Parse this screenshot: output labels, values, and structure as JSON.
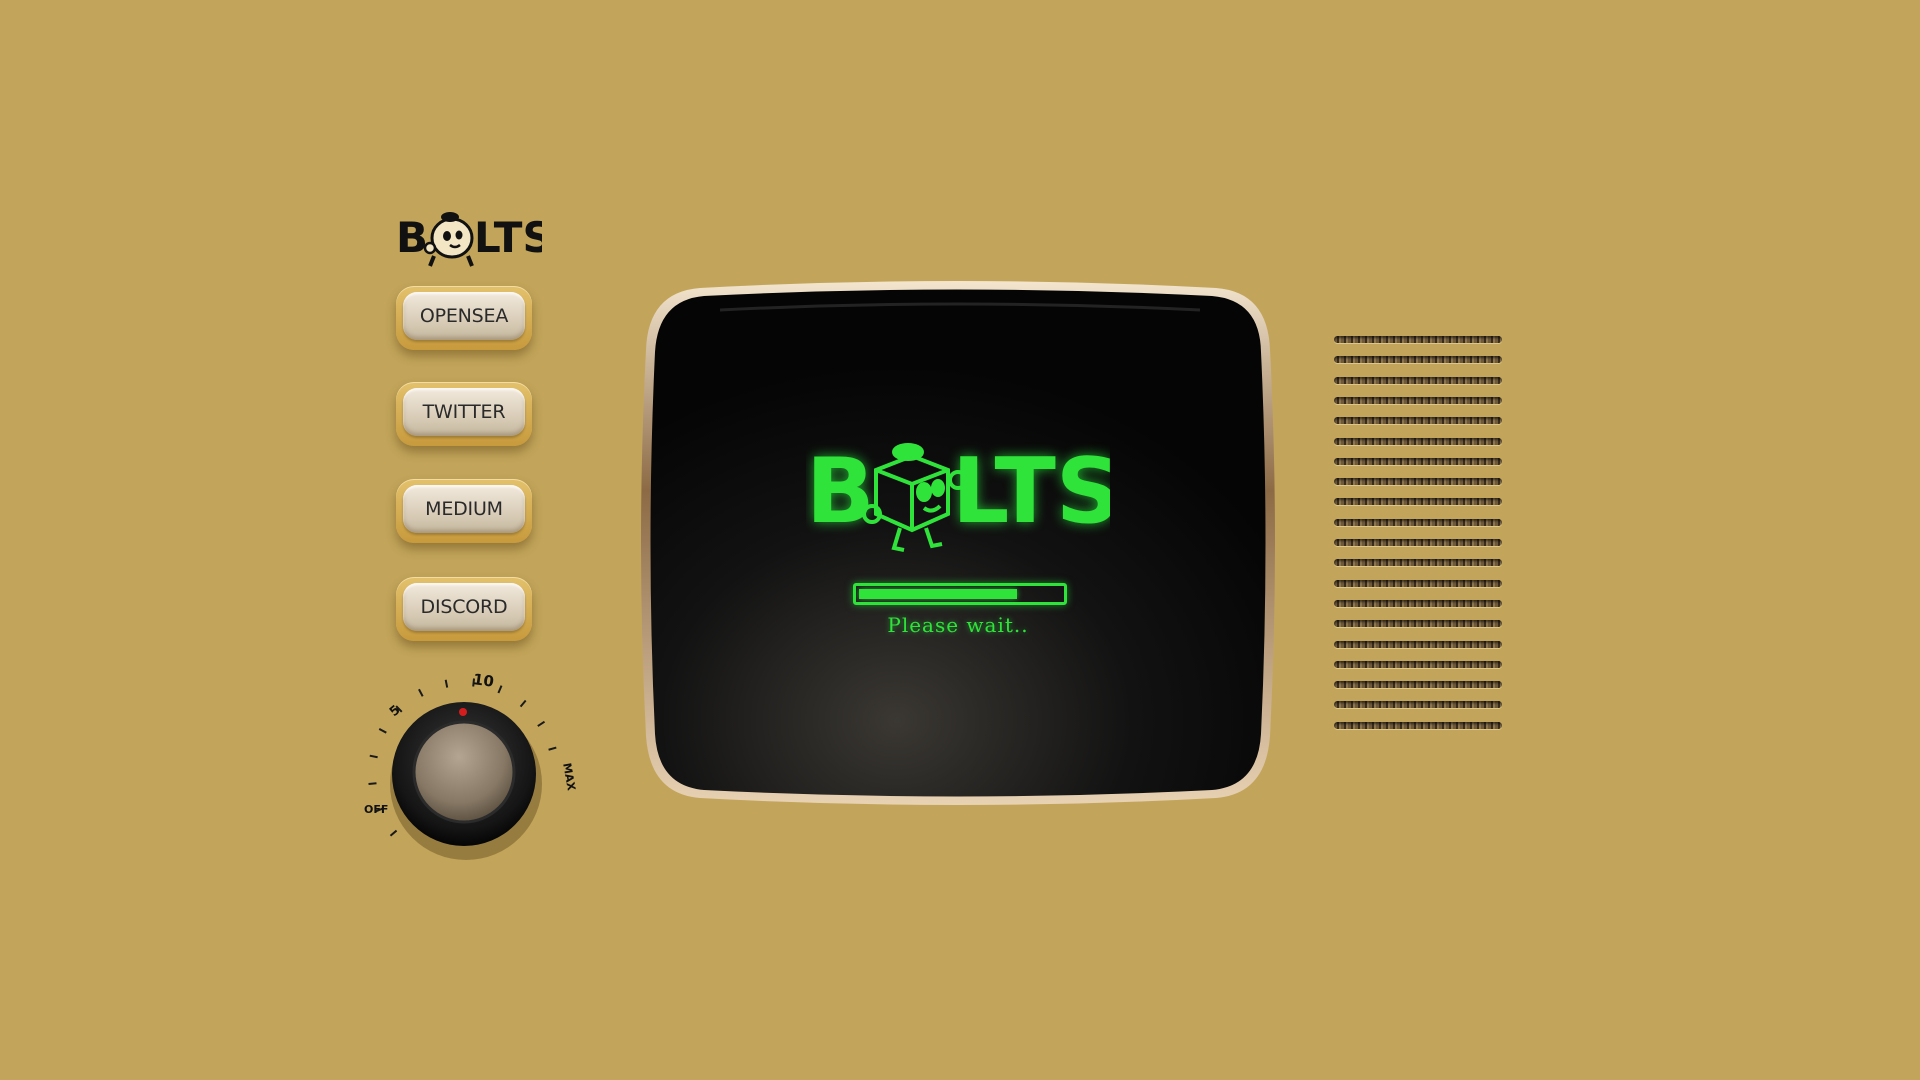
{
  "brand": {
    "logo_text": "BOLTS",
    "logo_icon": "bolt-mascot-icon"
  },
  "nav": {
    "buttons": [
      {
        "label": "OPENSEA"
      },
      {
        "label": "TWITTER"
      },
      {
        "label": "MEDIUM"
      },
      {
        "label": "DISCORD"
      }
    ]
  },
  "knob": {
    "labels": {
      "off": "OFF",
      "five": "5",
      "ten": "10",
      "max": "MAX"
    },
    "indicator_color": "#d61d1d"
  },
  "screen": {
    "logo_text": "BOLTS",
    "progress_fraction": 0.78,
    "loading_text": "Please wait..",
    "glow_color": "#2fe33a"
  },
  "speaker": {
    "slot_count": 20
  },
  "colors": {
    "background": "#c2a55a",
    "button_face": "#e4dccd",
    "screen": "#0b0b0b"
  }
}
